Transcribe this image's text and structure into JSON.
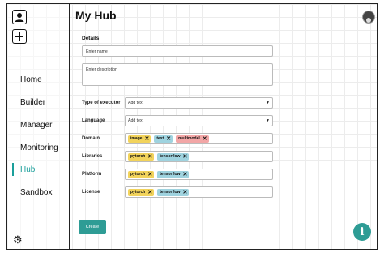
{
  "header": {
    "title": "My Hub"
  },
  "sidebar": {
    "top_icons": [
      "user-icon",
      "plus-icon"
    ],
    "items": [
      {
        "label": "Home"
      },
      {
        "label": "Builder"
      },
      {
        "label": "Manager"
      },
      {
        "label": "Monitoring"
      },
      {
        "label": "Hub",
        "active": true
      },
      {
        "label": "Sandbox"
      }
    ],
    "settings_icon": "gear-icon"
  },
  "form": {
    "section_title": "Details",
    "name_placeholder": "Enter name",
    "description_placeholder": "Enter description",
    "executor": {
      "label": "Type of executor",
      "value": "Add text"
    },
    "language": {
      "label": "Language",
      "value": "Add text"
    },
    "domain": {
      "label": "Domain",
      "chips": [
        {
          "text": "image",
          "color": "#f2d35b"
        },
        {
          "text": "text",
          "color": "#9fd3df"
        },
        {
          "text": "multimodel",
          "color": "#f2a6a6"
        }
      ]
    },
    "libraries": {
      "label": "Libraries",
      "chips": [
        {
          "text": "pytorch",
          "color": "#f2d35b"
        },
        {
          "text": "tensorflow",
          "color": "#9fd3df"
        }
      ]
    },
    "platform": {
      "label": "Platform",
      "chips": [
        {
          "text": "pytorch",
          "color": "#f2d35b"
        },
        {
          "text": "tensorflow",
          "color": "#9fd3df"
        }
      ]
    },
    "license": {
      "label": "License",
      "chips": [
        {
          "text": "pytorch",
          "color": "#f2d35b"
        },
        {
          "text": "tensorflow",
          "color": "#9fd3df"
        }
      ]
    },
    "create_label": "Create"
  },
  "colors": {
    "accent": "#2e9c95",
    "active_nav": "#1a9f9b"
  },
  "info_button": {
    "glyph": "i"
  }
}
